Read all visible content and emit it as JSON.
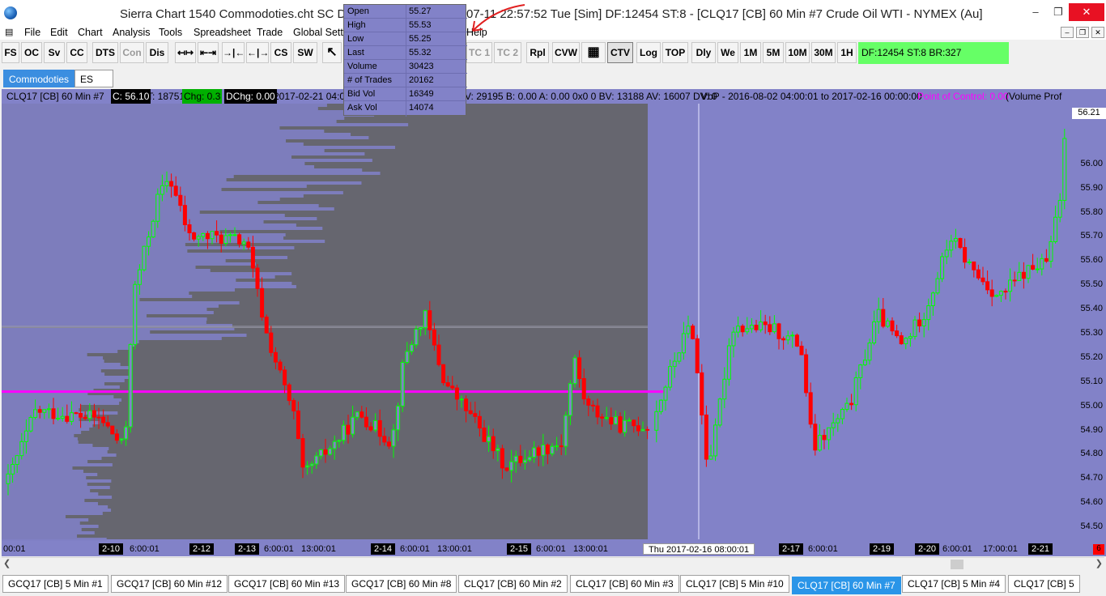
{
  "window": {
    "title": "Sierra Chart 1540 Commodoties.cht  SC D",
    "title_tail": "07-11  22:57:52 Tue [Sim]   DF:12454   ST:8 - [CLQ17 [CB]   60 Min   #7  Crude Oil WTI - NYMEX (Au]",
    "minimize": "–",
    "restore": "❐",
    "close": "✕"
  },
  "menu": [
    "File",
    "Edit",
    "Chart",
    "Analysis",
    "Tools",
    "Spreadsheet",
    "Trade",
    "Global Settin",
    "Help"
  ],
  "mdi_buttons": [
    "–",
    "❐",
    "✕"
  ],
  "toolbar": {
    "buttons": [
      "FS",
      "OC",
      "Sv",
      "CC",
      "DTS",
      "Con",
      "Dis",
      "CS",
      "SW",
      "Rpl",
      "CVW",
      "CTV",
      "Log",
      "TOP",
      "Dly",
      "We",
      "1M",
      "5M",
      "10M",
      "30M",
      "1H"
    ],
    "disabled": [
      "Con",
      "TC 1",
      "TC 2"
    ],
    "tc": [
      "TC 1",
      "TC 2"
    ],
    "active": "CTV",
    "status": "DF:12454  ST:8  BR:327"
  },
  "top_tabs": [
    {
      "label": "Commodoties",
      "active": true
    },
    {
      "label": "ES",
      "active": false
    }
  ],
  "chart_header": {
    "symbol": "CLQ17 [CB]  60 Min   #7",
    "close": "C: 56.10",
    "ticks": "T: 18751",
    "chg": "Chg: 0.3",
    "dchg": "DChg: 0.00",
    "date": "2017-02-21 04:00",
    "vol_info": "V: 29195  B: 0.00  A: 0.00  0x0 0  BV: 13188  AV: 16007  DV: 0",
    "vbp": "VbP - 2016-08-02  04:00:01 to 2017-02-16  00:00:00",
    "poc": "Point of Control: 0.00",
    "vp": "(Volume Prof"
  },
  "chart_data": {
    "type": "candlestick",
    "ylim": [
      54.45,
      56.25
    ],
    "y_ticks": [
      "56.00",
      "55.90",
      "55.80",
      "55.70",
      "55.60",
      "55.50",
      "55.40",
      "55.30",
      "55.20",
      "55.10",
      "55.00",
      "54.90",
      "54.80",
      "54.70",
      "54.60",
      "54.50"
    ],
    "last_price": "56.21",
    "point_of_control": 55.06,
    "x_labels": [
      "00:01",
      "2-10",
      "6:00:01",
      "2-12",
      "2-13",
      "6:00:01",
      "13:00:01",
      "2-14",
      "6:00:01",
      "13:00:01",
      "2-15",
      "6:00:01",
      "13:00:01",
      "Thu 2017-02-16  08:00:01",
      "2-17",
      "6:00:01",
      "2-19",
      "2-20",
      "6:00:01",
      "17:00:01",
      "2-21",
      "6"
    ],
    "up_color": "#00ff00",
    "down_color": "#ff0000"
  },
  "popup": {
    "rows": [
      {
        "label": "Open",
        "value": "55.27"
      },
      {
        "label": "High",
        "value": "55.53"
      },
      {
        "label": "Low",
        "value": "55.25"
      },
      {
        "label": "Last",
        "value": "55.32"
      },
      {
        "label": "Volume",
        "value": "30423"
      },
      {
        "label": "# of Trades",
        "value": "20162"
      },
      {
        "label": "Bid Vol",
        "value": "16349"
      },
      {
        "label": "Ask Vol",
        "value": "14074"
      }
    ]
  },
  "bottom_tabs": [
    {
      "label": "GCQ17 [CB]  5 Min  #1",
      "active": false
    },
    {
      "label": "GCQ17 [CB]  60 Min  #12",
      "active": false
    },
    {
      "label": "GCQ17 [CB]  60 Min  #13",
      "active": false
    },
    {
      "label": "GCQ17 [CB]  60 Min  #8",
      "active": false
    },
    {
      "label": "CLQ17 [CB]  60 Min  #2",
      "active": false
    },
    {
      "label": "CLQ17 [CB]  60 Min  #3",
      "active": false
    },
    {
      "label": "CLQ17 [CB]  5 Min  #10",
      "active": false
    },
    {
      "label": "CLQ17 [CB]  60 Min  #7",
      "active": true
    },
    {
      "label": "CLQ17 [CB]  5 Min  #4",
      "active": false
    },
    {
      "label": "CLQ17 [CB]  5",
      "active": false
    }
  ]
}
